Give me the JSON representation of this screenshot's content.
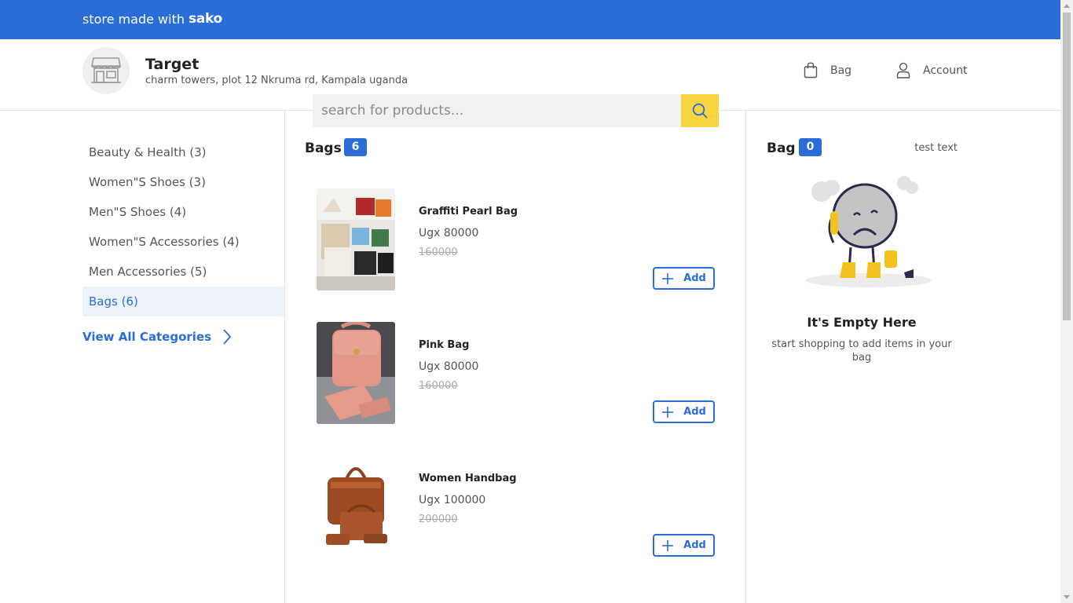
{
  "topbar": {
    "brand_text": "store made with",
    "brand_logo": "sako"
  },
  "store": {
    "name": "Target",
    "address": "charm towers, plot 12 Nkruma rd, Kampala uganda"
  },
  "nav": {
    "bag_label": "Bag",
    "account_label": "Account"
  },
  "search": {
    "placeholder": "search for products..."
  },
  "sidebar": {
    "categories": [
      {
        "label": "Beauty & Health (3)",
        "active": false
      },
      {
        "label": "Women\"S Shoes (3)",
        "active": false
      },
      {
        "label": "Men\"S Shoes (4)",
        "active": false
      },
      {
        "label": "Women\"S Accessories (4)",
        "active": false
      },
      {
        "label": "Men Accessories (5)",
        "active": false
      },
      {
        "label": "Bags (6)",
        "active": true
      }
    ],
    "view_all_label": "View All Categories"
  },
  "products_section": {
    "title": "Bags",
    "count": "6",
    "items": [
      {
        "name": "Graffiti Pearl Bag",
        "price": "Ugx 80000",
        "old_price": "160000",
        "add_label": "Add"
      },
      {
        "name": "Pink Bag",
        "price": "Ugx 80000",
        "old_price": "160000",
        "add_label": "Add"
      },
      {
        "name": "Women Handbag",
        "price": "Ugx 100000",
        "old_price": "200000",
        "add_label": "Add"
      }
    ]
  },
  "bag_panel": {
    "title": "Bag",
    "count": "0",
    "test_text": "test text",
    "empty_title": "It's Empty Here",
    "empty_subtitle": "start shopping to add items in your bag"
  },
  "colors": {
    "primary": "#2a6dd9",
    "search_button": "#f6d53e",
    "active_bg": "#edf2fb"
  }
}
